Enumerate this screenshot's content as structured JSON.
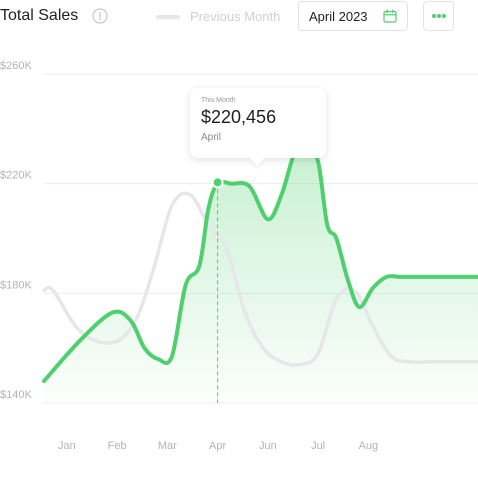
{
  "header": {
    "title": "Total Sales",
    "legend_label": "Previous Month",
    "month_value": "April 2023",
    "icons": {
      "info": "info-icon",
      "calendar": "calendar-icon",
      "more": "more-dots-icon"
    }
  },
  "tooltip": {
    "caption": "This Month",
    "value": "$220,456",
    "month": "April"
  },
  "colors": {
    "accent": "#4ed06e",
    "previous": "#e6e6eb",
    "grid": "#ececec"
  },
  "chart_data": {
    "type": "line",
    "x": [
      0.8,
      1,
      1.5,
      1.8,
      2,
      2.3,
      2.6,
      2.9,
      3,
      3.3,
      3.5,
      3.7,
      4,
      4.3,
      4.6,
      5,
      5.3,
      5.6,
      5.8,
      6,
      6.3,
      6.5,
      6.7,
      7,
      7.3,
      7.6,
      8,
      8.3,
      8.6,
      9,
      9.3,
      9.6,
      9.8,
      10,
      10.3
    ],
    "categories": [
      "Jan",
      "Feb",
      "Mar",
      "Apr",
      "Jun",
      "Jul",
      "Aug"
    ],
    "ylim": [
      140000,
      260000
    ],
    "yticks": [
      "$140K",
      "$180K",
      "$220K",
      "$260K"
    ],
    "series": [
      {
        "values": [
          148000,
          153000,
          163000,
          170000,
          173000,
          170000,
          160000,
          156000,
          157000,
          170000,
          183000,
          190000,
          211000,
          220000,
          220000,
          211000,
          207000,
          216000,
          228000,
          235000,
          230000,
          222000,
          205000,
          200000,
          185000,
          175000,
          182000,
          186000,
          186000,
          186000,
          186000,
          186000,
          186000,
          186000,
          186000
        ]
      },
      {
        "values": [
          181000,
          181000,
          170000,
          162000,
          160000,
          162000,
          171000,
          185000,
          189000,
          200000,
          212000,
          216000,
          214000,
          205000,
          196000,
          183000,
          169000,
          160000,
          157000,
          155000,
          154000,
          155000,
          160000,
          176000,
          181000,
          173000,
          167000,
          160000,
          155000,
          155000,
          155000,
          155000,
          155000,
          155000,
          155000
        ]
      }
    ],
    "highlight": {
      "category": "Apr",
      "value": 220456
    }
  }
}
